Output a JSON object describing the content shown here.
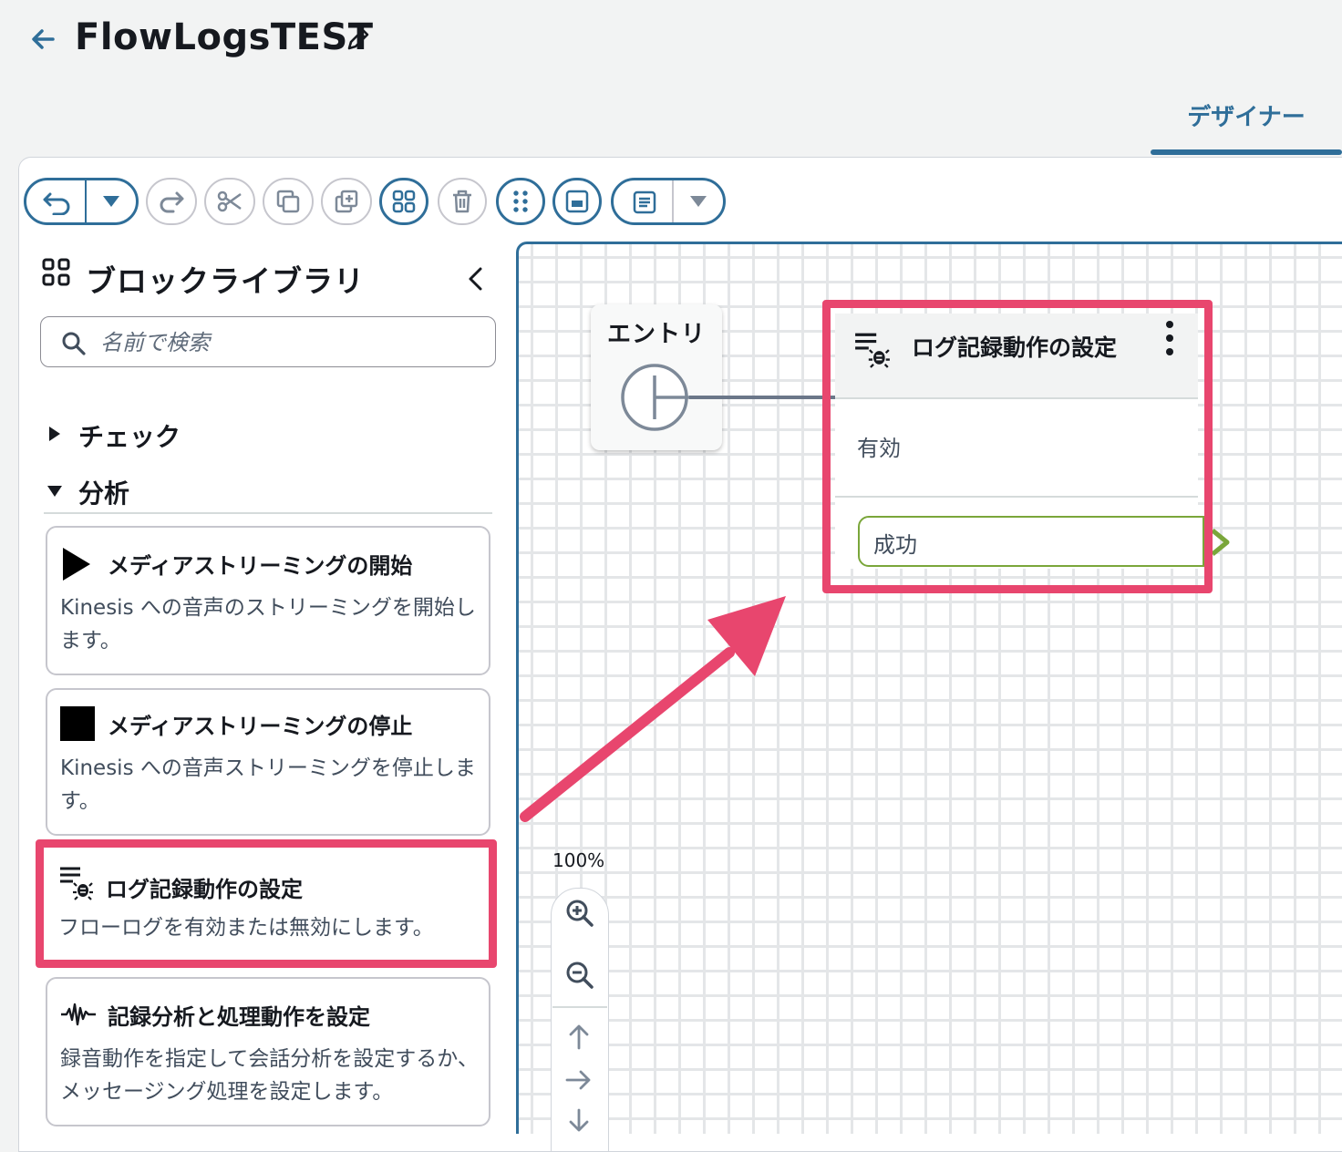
{
  "header": {
    "back_icon": "arrow-left-icon",
    "title": "FlowLogsTEST",
    "edit_icon": "pencil-icon"
  },
  "tabs": [
    {
      "label": "デザイナー",
      "active": true
    }
  ],
  "toolbar": {
    "buttons": [
      {
        "name": "undo",
        "icon": "undo-icon"
      },
      {
        "name": "undo-menu",
        "icon": "caret-down-icon"
      },
      {
        "name": "redo",
        "icon": "redo-icon"
      },
      {
        "name": "cut",
        "icon": "scissors-icon"
      },
      {
        "name": "copy",
        "icon": "copy-icon"
      },
      {
        "name": "duplicate",
        "icon": "duplicate-icon"
      },
      {
        "name": "block-library",
        "icon": "grid-icon"
      },
      {
        "name": "delete",
        "icon": "trash-icon"
      },
      {
        "name": "arrange",
        "icon": "drag-dots-icon"
      },
      {
        "name": "minimap",
        "icon": "minimap-icon"
      },
      {
        "name": "details",
        "icon": "document-icon"
      },
      {
        "name": "details-menu",
        "icon": "caret-down-icon"
      }
    ]
  },
  "sidebar": {
    "title": "ブロックライブラリ",
    "search_placeholder": "名前で検索",
    "categories": [
      {
        "label": "チェック",
        "expanded": false
      },
      {
        "label": "分析",
        "expanded": true
      }
    ],
    "blocks": [
      {
        "title": "メディアストリーミングの開始",
        "description": "Kinesis への音声のストリーミングを開始します。",
        "icon": "play-icon"
      },
      {
        "title": "メディアストリーミングの停止",
        "description": "Kinesis への音声ストリーミングを停止します。",
        "icon": "stop-icon"
      },
      {
        "title": "ログ記録動作の設定",
        "description": "フローログを有効または無効にします。",
        "icon": "logging-bug-icon",
        "highlighted": true
      },
      {
        "title": "記録分析と処理動作を設定",
        "description": "録音動作を指定して会話分析を設定するか、メッセージング処理を設定します。",
        "icon": "waveform-icon"
      }
    ]
  },
  "canvas": {
    "entry_node": {
      "label": "エントリ"
    },
    "logging_node": {
      "title": "ログ記録動作の設定",
      "status": "有効",
      "branch": "成功"
    },
    "zoom": {
      "level": "100%",
      "controls": [
        "zoom-in-icon",
        "zoom-out-icon",
        "pan-up-icon",
        "pan-right-icon",
        "pan-down-icon"
      ]
    }
  },
  "colors": {
    "highlight": "#e8466e",
    "accent": "#2f6e99",
    "success": "#7aa63a"
  }
}
